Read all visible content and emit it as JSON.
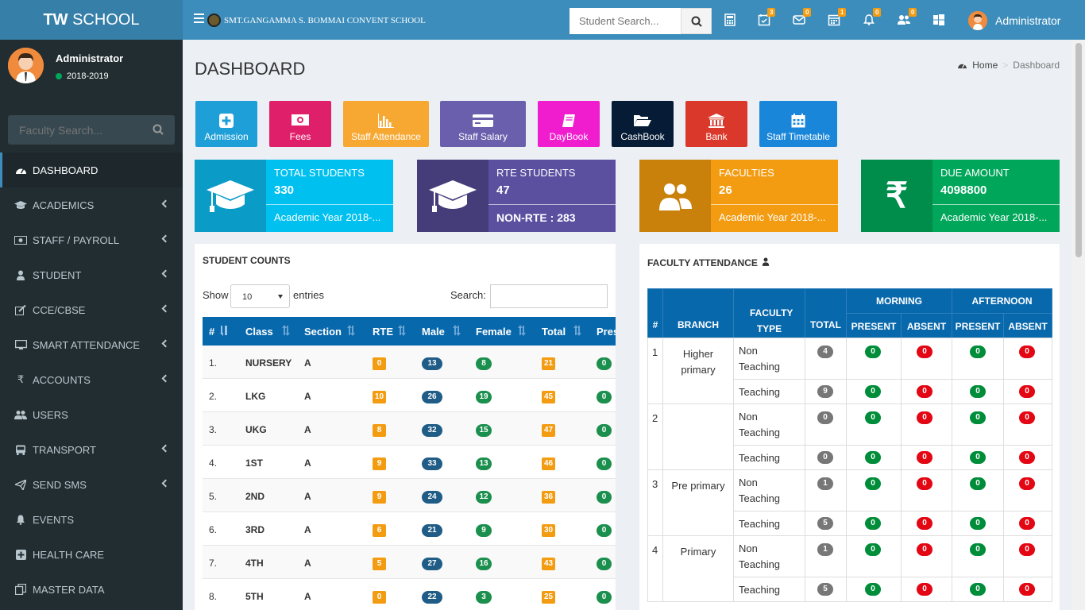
{
  "app": {
    "logo_bold": "TW",
    "logo_rest": " SCHOOL",
    "school_name": "SMT.GANGAMMA S. BOMMAI CONVENT SCHOOL"
  },
  "topbar": {
    "search_placeholder": "Student Search...",
    "badges": {
      "tasks": "3",
      "mail": "0",
      "calendar": "1",
      "notifications": "0",
      "users": "0"
    },
    "user_name": "Administrator"
  },
  "sidebar": {
    "user_name": "Administrator",
    "status": "2018-2019",
    "search_placeholder": "Faculty Search...",
    "items": [
      {
        "label": "DASHBOARD",
        "icon": "dashboard-icon"
      },
      {
        "label": "ACADEMICS",
        "icon": "graduation-cap-icon"
      },
      {
        "label": "STAFF / PAYROLL",
        "icon": "money-icon"
      },
      {
        "label": "STUDENT",
        "icon": "user-icon"
      },
      {
        "label": "CCE/CBSE",
        "icon": "edit-icon"
      },
      {
        "label": "SMART ATTENDANCE",
        "icon": "desktop-icon"
      },
      {
        "label": "ACCOUNTS",
        "icon": "rupee-icon"
      },
      {
        "label": "USERS",
        "icon": "users-icon"
      },
      {
        "label": "TRANSPORT",
        "icon": "bus-icon"
      },
      {
        "label": "SEND SMS",
        "icon": "paper-plane-icon"
      },
      {
        "label": "EVENTS",
        "icon": "bell-icon"
      },
      {
        "label": "HEALTH CARE",
        "icon": "plus-square-icon"
      },
      {
        "label": "MASTER DATA",
        "icon": "copy-icon"
      }
    ]
  },
  "page": {
    "title": "DASHBOARD",
    "breadcrumb_home": "Home",
    "breadcrumb_current": "Dashboard"
  },
  "quick_buttons": [
    {
      "label": "Admission",
      "color": "#1f9fd7"
    },
    {
      "label": "Fees",
      "color": "#e01f6a"
    },
    {
      "label": "Staff Attendance",
      "color": "#f7a833"
    },
    {
      "label": "Staff Salary",
      "color": "#6a5fad"
    },
    {
      "label": "DayBook",
      "color": "#ef1dce"
    },
    {
      "label": "CashBook",
      "color": "#061b35"
    },
    {
      "label": "Bank",
      "color": "#d9382a"
    },
    {
      "label": "Staff Timetable",
      "color": "#1a86d9"
    }
  ],
  "info_boxes": [
    {
      "title": "TOTAL STUDENTS",
      "number": "330",
      "footer": "Academic Year 2018-...",
      "icon": "graduation-cap-icon",
      "icon_bg": "#0a9cc7",
      "bg": "#00c0ef"
    },
    {
      "title": "RTE STUDENTS",
      "number": "47",
      "footer": "NON-RTE : 283",
      "icon": "graduation-cap-icon",
      "icon_bg": "#453d7a",
      "bg": "#5b4fa0"
    },
    {
      "title": "FACULTIES",
      "number": "26",
      "footer": "Academic Year 2018-...",
      "icon": "users-icon",
      "icon_bg": "#c9810b",
      "bg": "#f39c12"
    },
    {
      "title": "DUE AMOUNT",
      "number": "4098800",
      "footer": "Academic Year 2018-...",
      "icon": "rupee-icon",
      "icon_bg": "#008d4c",
      "bg": "#00a65a"
    }
  ],
  "student_counts": {
    "title": "STUDENT COUNTS",
    "show_label": "Show",
    "entries_value": "10",
    "entries_label": "entries",
    "search_label": "Search:",
    "columns": [
      "#",
      "Class",
      "Section",
      "RTE",
      "Male",
      "Female",
      "Total",
      "Pres"
    ],
    "rows": [
      {
        "n": "1.",
        "cls": "NURSERY",
        "sec": "A",
        "rte": "0",
        "male": "13",
        "female": "8",
        "total": "21",
        "pres": "0"
      },
      {
        "n": "2.",
        "cls": "LKG",
        "sec": "A",
        "rte": "10",
        "male": "26",
        "female": "19",
        "total": "45",
        "pres": "0"
      },
      {
        "n": "3.",
        "cls": "UKG",
        "sec": "A",
        "rte": "8",
        "male": "32",
        "female": "15",
        "total": "47",
        "pres": "0"
      },
      {
        "n": "4.",
        "cls": "1ST",
        "sec": "A",
        "rte": "9",
        "male": "33",
        "female": "13",
        "total": "46",
        "pres": "0"
      },
      {
        "n": "5.",
        "cls": "2ND",
        "sec": "A",
        "rte": "9",
        "male": "24",
        "female": "12",
        "total": "36",
        "pres": "0"
      },
      {
        "n": "6.",
        "cls": "3RD",
        "sec": "A",
        "rte": "6",
        "male": "21",
        "female": "9",
        "total": "30",
        "pres": "0"
      },
      {
        "n": "7.",
        "cls": "4TH",
        "sec": "A",
        "rte": "5",
        "male": "27",
        "female": "16",
        "total": "43",
        "pres": "0"
      },
      {
        "n": "8.",
        "cls": "5TH",
        "sec": "A",
        "rte": "0",
        "male": "22",
        "female": "3",
        "total": "25",
        "pres": "0"
      }
    ]
  },
  "faculty_attendance": {
    "title": "FACULTY ATTENDANCE",
    "headers": {
      "num": "#",
      "branch": "BRANCH",
      "type": "FACULTY TYPE",
      "total": "TOTAL",
      "morning": "MORNING",
      "afternoon": "AFTERNOON",
      "present": "PRESENT",
      "absent": "ABSENT"
    },
    "groups": [
      {
        "n": "1",
        "branch": "Higher primary",
        "rows": [
          {
            "type": "Non Teaching",
            "total": "4",
            "mp": "0",
            "ma": "0",
            "ap": "0",
            "aa": "0"
          },
          {
            "type": "Teaching",
            "total": "9",
            "mp": "0",
            "ma": "0",
            "ap": "0",
            "aa": "0"
          }
        ]
      },
      {
        "n": "2",
        "branch": "",
        "rows": [
          {
            "type": "Non Teaching",
            "total": "0",
            "mp": "0",
            "ma": "0",
            "ap": "0",
            "aa": "0"
          },
          {
            "type": "Teaching",
            "total": "0",
            "mp": "0",
            "ma": "0",
            "ap": "0",
            "aa": "0"
          }
        ]
      },
      {
        "n": "3",
        "branch": "Pre primary",
        "rows": [
          {
            "type": "Non Teaching",
            "total": "1",
            "mp": "0",
            "ma": "0",
            "ap": "0",
            "aa": "0"
          },
          {
            "type": "Teaching",
            "total": "5",
            "mp": "0",
            "ma": "0",
            "ap": "0",
            "aa": "0"
          }
        ]
      },
      {
        "n": "4",
        "branch": "Primary",
        "rows": [
          {
            "type": "Non Teaching",
            "total": "1",
            "mp": "0",
            "ma": "0",
            "ap": "0",
            "aa": "0"
          },
          {
            "type": "Teaching",
            "total": "5",
            "mp": "0",
            "ma": "0",
            "ap": "0",
            "aa": "0"
          }
        ]
      }
    ]
  }
}
